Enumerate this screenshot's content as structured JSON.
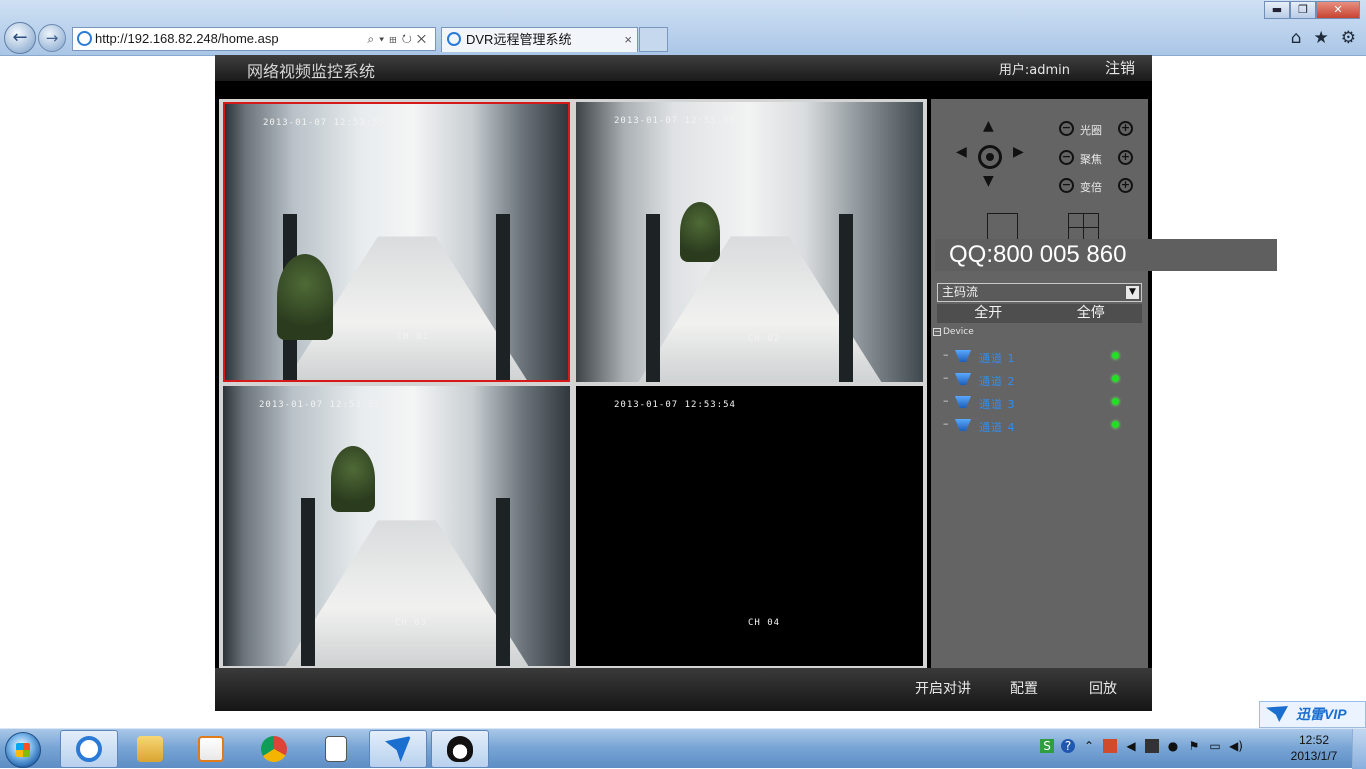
{
  "browser": {
    "address_url": "http://192.168.82.248/home.asp",
    "tab_title": "DVR远程管理系统",
    "tab_close": "×",
    "minimize": "▬",
    "restore": "❐",
    "close": "✕",
    "icons": [
      "back-arrow-icon",
      "forward-arrow-icon",
      "home-icon",
      "star-icon",
      "gear-icon"
    ]
  },
  "app": {
    "title": "网络视频监控系统",
    "user_label": "用户:admin",
    "logout": "注销"
  },
  "video": {
    "cells": [
      {
        "timestamp": "2013-01-07 12:53:55",
        "channel_label": "CH 01"
      },
      {
        "timestamp": "2013-01-07 12:53:55",
        "channel_label": "CH 02"
      },
      {
        "timestamp": "2013-01-07 12:53:55",
        "channel_label": "CH 03"
      },
      {
        "timestamp": "2013-01-07 12:53:54",
        "channel_label": "CH 04"
      }
    ]
  },
  "panel": {
    "ptz_up": "▲",
    "ptz_down": "▼",
    "ptz_left": "◀",
    "ptz_right": "▶",
    "adjust": [
      {
        "label": "光圈",
        "minus": "−",
        "plus": "+"
      },
      {
        "label": "聚焦",
        "minus": "−",
        "plus": "+"
      },
      {
        "label": "变倍",
        "minus": "−",
        "plus": "+"
      }
    ],
    "qq": "QQ:800 005 860",
    "stream_selected": "主码流",
    "dropdown_arrow": "▼",
    "open_all": "全开",
    "stop_all": "全停",
    "tree_toggle": "−",
    "tree_root": "Device",
    "tree_dash": "–",
    "channels": [
      {
        "name": "通道 1",
        "status_color": "#22e022"
      },
      {
        "name": "通道 2",
        "status_color": "#22e022"
      },
      {
        "name": "通道 3",
        "status_color": "#22e022"
      },
      {
        "name": "通道 4",
        "status_color": "#22e022"
      }
    ]
  },
  "footer": {
    "talk": "开启对讲",
    "config": "配置",
    "playback": "回放"
  },
  "taskbar": {
    "xunlei_label": "迅雷VIP",
    "time": "12:52",
    "date": "2013/1/7",
    "apps": [
      "internet-explorer-icon",
      "file-explorer-icon",
      "media-player-icon",
      "chrome-icon",
      "notepad-icon",
      "xunlei-icon",
      "qq-icon"
    ]
  },
  "colors": {
    "selected_cell_border": "#d61a1a",
    "channel_link": "#2f8df0",
    "status_online": "#22e022"
  }
}
